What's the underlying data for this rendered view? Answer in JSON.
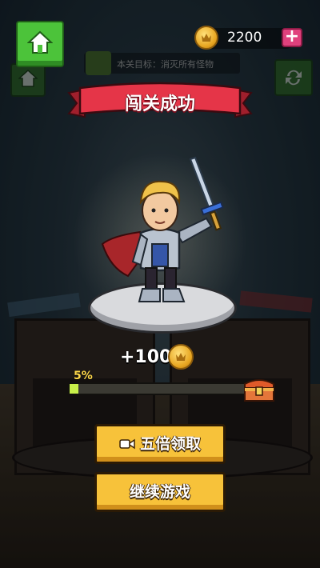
{
  "header": {
    "coin_count": "2200",
    "objective": "本关目标：消灭所有怪物"
  },
  "result": {
    "title": "闯关成功",
    "reward": "+100",
    "progress_label": "5%",
    "progress": 0.05
  },
  "buttons": {
    "five_times": "五倍领取",
    "continue": "继续游戏"
  },
  "icons": [
    "home-icon",
    "coin-icon",
    "plus-icon",
    "refresh-icon",
    "video-icon",
    "treasure-chest-icon",
    "crown-icon"
  ],
  "colors": {
    "button_yellow": "#f7c23a",
    "home_green": "#4cc33a",
    "banner_red": "#e53548",
    "progress_green": "#c8f04a",
    "plus_pink": "#e0417d"
  }
}
